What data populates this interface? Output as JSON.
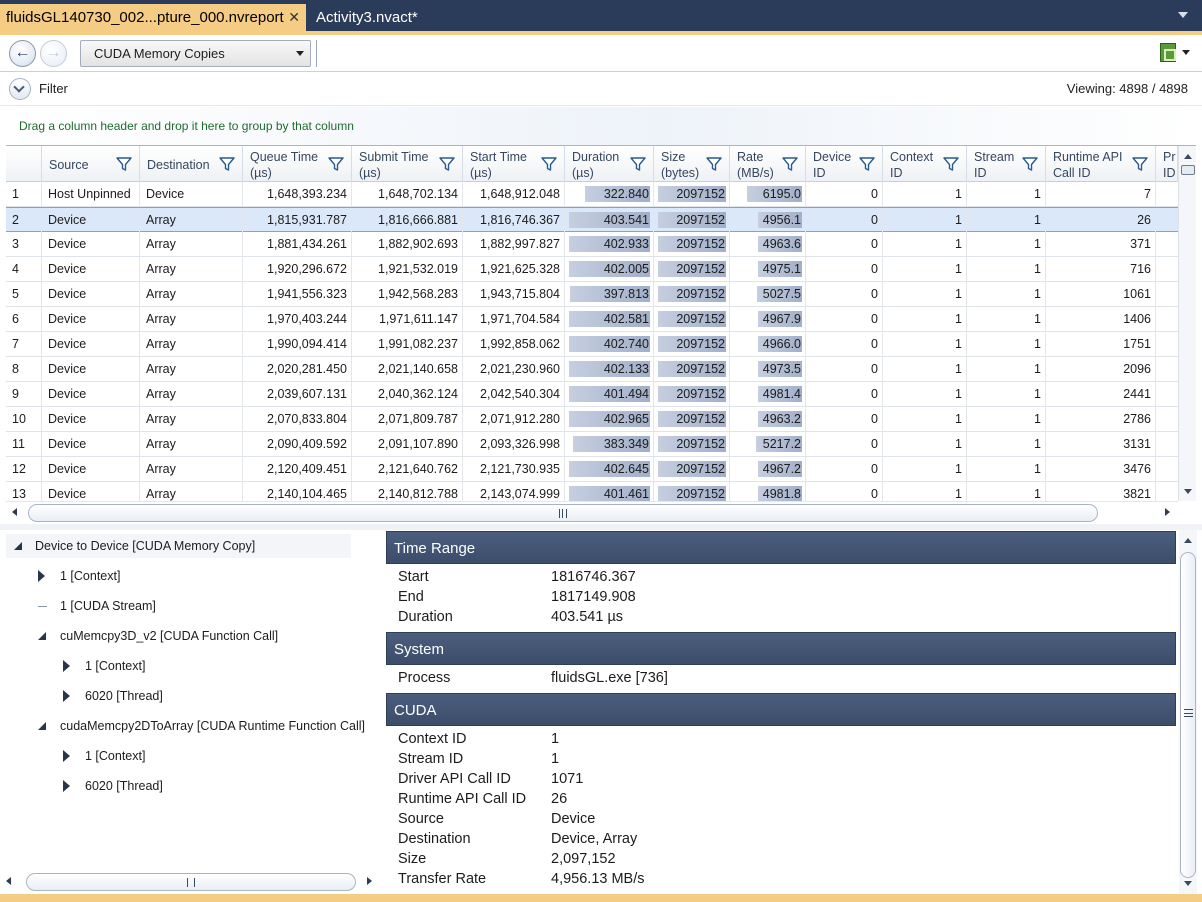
{
  "tabs": [
    {
      "label": "fluidsGL140730_002...pture_000.nvreport",
      "active": true
    },
    {
      "label": "Activity3.nvact*",
      "active": false
    }
  ],
  "toolbar": {
    "view_selected": "CUDA Memory Copies"
  },
  "filter": {
    "label": "Filter",
    "viewing": "Viewing: 4898 / 4898"
  },
  "group_hint": "Drag a column header and drop it here to group by that column",
  "grid": {
    "columns": [
      {
        "key": "idx",
        "label": ""
      },
      {
        "key": "source",
        "label": "Source"
      },
      {
        "key": "destination",
        "label": "Destination"
      },
      {
        "key": "queue",
        "label": "Queue Time\n(µs)"
      },
      {
        "key": "submit",
        "label": "Submit Time\n(µs)"
      },
      {
        "key": "start",
        "label": "Start Time\n(µs)"
      },
      {
        "key": "duration",
        "label": "Duration\n(µs)"
      },
      {
        "key": "size",
        "label": "Size\n(bytes)"
      },
      {
        "key": "rate",
        "label": "Rate\n(MB/s)"
      },
      {
        "key": "device",
        "label": "Device\nID"
      },
      {
        "key": "context",
        "label": "Context\nID"
      },
      {
        "key": "stream",
        "label": "Stream\nID"
      },
      {
        "key": "runtime",
        "label": "Runtime API\nCall ID"
      },
      {
        "key": "pr",
        "label": "Pr\nID"
      }
    ],
    "rows": [
      {
        "idx": "1",
        "source": "Host Unpinned",
        "destination": "Device",
        "queue": "1,648,393.234",
        "submit": "1,648,702.134",
        "start": "1,648,912.048",
        "duration": "322.840",
        "size": "2097152",
        "rate": "6195.0",
        "device": "0",
        "context": "1",
        "stream": "1",
        "runtime": "7",
        "selected": false,
        "duration_frac": 0.8,
        "size_frac": 1.0,
        "rate_frac": 0.81
      },
      {
        "idx": "2",
        "source": "Device",
        "destination": "Array",
        "queue": "1,815,931.787",
        "submit": "1,816,666.881",
        "start": "1,816,746.367",
        "duration": "403.541",
        "size": "2097152",
        "rate": "4956.1",
        "device": "0",
        "context": "1",
        "stream": "1",
        "runtime": "26",
        "selected": true,
        "duration_frac": 1.0,
        "size_frac": 1.0,
        "rate_frac": 0.65
      },
      {
        "idx": "3",
        "source": "Device",
        "destination": "Array",
        "queue": "1,881,434.261",
        "submit": "1,882,902.693",
        "start": "1,882,997.827",
        "duration": "402.933",
        "size": "2097152",
        "rate": "4963.6",
        "device": "0",
        "context": "1",
        "stream": "1",
        "runtime": "371",
        "selected": false,
        "duration_frac": 0.998,
        "size_frac": 1.0,
        "rate_frac": 0.65
      },
      {
        "idx": "4",
        "source": "Device",
        "destination": "Array",
        "queue": "1,920,296.672",
        "submit": "1,921,532.019",
        "start": "1,921,625.328",
        "duration": "402.005",
        "size": "2097152",
        "rate": "4975.1",
        "device": "0",
        "context": "1",
        "stream": "1",
        "runtime": "716",
        "selected": false,
        "duration_frac": 0.996,
        "size_frac": 1.0,
        "rate_frac": 0.65
      },
      {
        "idx": "5",
        "source": "Device",
        "destination": "Array",
        "queue": "1,941,556.323",
        "submit": "1,942,568.283",
        "start": "1,943,715.804",
        "duration": "397.813",
        "size": "2097152",
        "rate": "5027.5",
        "device": "0",
        "context": "1",
        "stream": "1",
        "runtime": "1061",
        "selected": false,
        "duration_frac": 0.986,
        "size_frac": 1.0,
        "rate_frac": 0.66
      },
      {
        "idx": "6",
        "source": "Device",
        "destination": "Array",
        "queue": "1,970,403.244",
        "submit": "1,971,611.147",
        "start": "1,971,704.584",
        "duration": "402.581",
        "size": "2097152",
        "rate": "4967.9",
        "device": "0",
        "context": "1",
        "stream": "1",
        "runtime": "1406",
        "selected": false,
        "duration_frac": 0.997,
        "size_frac": 1.0,
        "rate_frac": 0.65
      },
      {
        "idx": "7",
        "source": "Device",
        "destination": "Array",
        "queue": "1,990,094.414",
        "submit": "1,991,082.237",
        "start": "1,992,858.062",
        "duration": "402.740",
        "size": "2097152",
        "rate": "4966.0",
        "device": "0",
        "context": "1",
        "stream": "1",
        "runtime": "1751",
        "selected": false,
        "duration_frac": 0.998,
        "size_frac": 1.0,
        "rate_frac": 0.65
      },
      {
        "idx": "8",
        "source": "Device",
        "destination": "Array",
        "queue": "2,020,281.450",
        "submit": "2,021,140.658",
        "start": "2,021,230.960",
        "duration": "402.133",
        "size": "2097152",
        "rate": "4973.5",
        "device": "0",
        "context": "1",
        "stream": "1",
        "runtime": "2096",
        "selected": false,
        "duration_frac": 0.996,
        "size_frac": 1.0,
        "rate_frac": 0.65
      },
      {
        "idx": "9",
        "source": "Device",
        "destination": "Array",
        "queue": "2,039,607.131",
        "submit": "2,040,362.124",
        "start": "2,042,540.304",
        "duration": "401.494",
        "size": "2097152",
        "rate": "4981.4",
        "device": "0",
        "context": "1",
        "stream": "1",
        "runtime": "2441",
        "selected": false,
        "duration_frac": 0.995,
        "size_frac": 1.0,
        "rate_frac": 0.65
      },
      {
        "idx": "10",
        "source": "Device",
        "destination": "Array",
        "queue": "2,070,833.804",
        "submit": "2,071,809.787",
        "start": "2,071,912.280",
        "duration": "402.965",
        "size": "2097152",
        "rate": "4963.2",
        "device": "0",
        "context": "1",
        "stream": "1",
        "runtime": "2786",
        "selected": false,
        "duration_frac": 0.998,
        "size_frac": 1.0,
        "rate_frac": 0.65
      },
      {
        "idx": "11",
        "source": "Device",
        "destination": "Array",
        "queue": "2,090,409.592",
        "submit": "2,091,107.890",
        "start": "2,093,326.998",
        "duration": "383.349",
        "size": "2097152",
        "rate": "5217.2",
        "device": "0",
        "context": "1",
        "stream": "1",
        "runtime": "3131",
        "selected": false,
        "duration_frac": 0.95,
        "size_frac": 1.0,
        "rate_frac": 0.68
      },
      {
        "idx": "12",
        "source": "Device",
        "destination": "Array",
        "queue": "2,120,409.451",
        "submit": "2,121,640.762",
        "start": "2,121,730.935",
        "duration": "402.645",
        "size": "2097152",
        "rate": "4967.2",
        "device": "0",
        "context": "1",
        "stream": "1",
        "runtime": "3476",
        "selected": false,
        "duration_frac": 0.998,
        "size_frac": 1.0,
        "rate_frac": 0.65
      },
      {
        "idx": "13",
        "source": "Device",
        "destination": "Array",
        "queue": "2,140,104.465",
        "submit": "2,140,812.788",
        "start": "2,143,074.999",
        "duration": "401.461",
        "size": "2097152",
        "rate": "4981.8",
        "device": "0",
        "context": "1",
        "stream": "1",
        "runtime": "3821",
        "selected": false,
        "duration_frac": 0.995,
        "size_frac": 1.0,
        "rate_frac": 0.65
      }
    ]
  },
  "tree": {
    "items": [
      {
        "label": "Device to Device [CUDA Memory Copy]",
        "level": 0,
        "state": "expanded"
      },
      {
        "label": "1 [Context]",
        "level": 1,
        "state": "collapsed"
      },
      {
        "label": "1 [CUDA Stream]",
        "level": 1,
        "state": "leaf"
      },
      {
        "label": "cuMemcpy3D_v2 [CUDA Function Call]",
        "level": 1,
        "state": "expanded"
      },
      {
        "label": "1 [Context]",
        "level": 2,
        "state": "collapsed"
      },
      {
        "label": "6020 [Thread]",
        "level": 2,
        "state": "collapsed"
      },
      {
        "label": "cudaMemcpy2DToArray [CUDA Runtime Function Call]",
        "level": 1,
        "state": "expanded"
      },
      {
        "label": "1 [Context]",
        "level": 2,
        "state": "collapsed"
      },
      {
        "label": "6020 [Thread]",
        "level": 2,
        "state": "collapsed"
      }
    ]
  },
  "properties": {
    "sections": [
      {
        "title": "Time Range",
        "rows": [
          {
            "key": "Start",
            "value": "1816746.367"
          },
          {
            "key": "End",
            "value": "1817149.908"
          },
          {
            "key": "Duration",
            "value": "403.541 µs"
          }
        ]
      },
      {
        "title": "System",
        "rows": [
          {
            "key": "Process",
            "value": "fluidsGL.exe [736]"
          }
        ]
      },
      {
        "title": "CUDA",
        "rows": [
          {
            "key": "Context ID",
            "value": "1"
          },
          {
            "key": "Stream ID",
            "value": "1"
          },
          {
            "key": "Driver API Call ID",
            "value": "1071"
          },
          {
            "key": "Runtime API Call ID",
            "value": "26"
          },
          {
            "key": "Source",
            "value": "Device"
          },
          {
            "key": "Destination",
            "value": "Device, Array"
          },
          {
            "key": "Size",
            "value": "2,097,152"
          },
          {
            "key": "Transfer Rate",
            "value": "4,956.13 MB/s"
          }
        ]
      }
    ]
  },
  "colors": {
    "tab_active": "#f5cc84",
    "tab_strip": "#2b3c5a",
    "section_header": "#455878",
    "group_hint_text": "#1f6b2d",
    "selection": "#dbe8f9"
  },
  "icons": {
    "back": "arrow-left-icon",
    "forward": "arrow-right-icon",
    "filter_column": "funnel-icon",
    "export": "export-sheet-icon"
  }
}
